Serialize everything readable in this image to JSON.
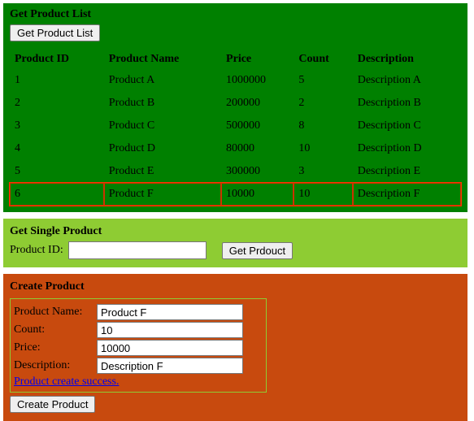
{
  "list_panel": {
    "heading": "Get Product List",
    "button": "Get Product List",
    "cols": [
      "Product ID",
      "Product Name",
      "Price",
      "Count",
      "Description"
    ],
    "rows": [
      {
        "id": "1",
        "name": "Product A",
        "price": "1000000",
        "count": "5",
        "desc": "Description A"
      },
      {
        "id": "2",
        "name": "Product B",
        "price": "200000",
        "count": "2",
        "desc": "Description B"
      },
      {
        "id": "3",
        "name": "Product C",
        "price": "500000",
        "count": "8",
        "desc": "Description C"
      },
      {
        "id": "4",
        "name": "Product D",
        "price": "80000",
        "count": "10",
        "desc": "Description D"
      },
      {
        "id": "5",
        "name": "Product E",
        "price": "300000",
        "count": "3",
        "desc": "Description E"
      },
      {
        "id": "6",
        "name": "Product F",
        "price": "10000",
        "count": "10",
        "desc": "Description F"
      }
    ],
    "highlight_index": 5
  },
  "single_panel": {
    "heading": "Get Single Product",
    "label": "Product ID:",
    "value": "",
    "button": "Get Prdouct"
  },
  "create_panel": {
    "heading": "Create Product",
    "fields": {
      "name_label": "Product Name:",
      "name_value": "Product F",
      "count_label": "Count:",
      "count_value": "10",
      "price_label": "Price:",
      "price_value": "10000",
      "desc_label": "Description:",
      "desc_value": "Description F"
    },
    "message": "Product create success.",
    "button": "Create Product"
  }
}
